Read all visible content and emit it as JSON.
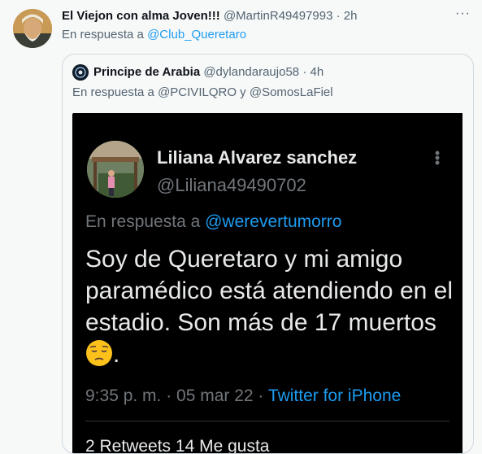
{
  "tweet": {
    "name": "El Viejon con alma Joven!!!",
    "handle": "@MartinR49497993",
    "sep": "·",
    "time": "2h",
    "more": "···",
    "reply_prefix": "En respuesta a",
    "reply_mention": "@Club_Queretaro"
  },
  "quote": {
    "name": "Principe de Arabia",
    "handle": "@dylandaraujo58",
    "sep": "·",
    "time": "4h",
    "reply_prefix": "En respuesta a",
    "reply_mention_1": "@PCIVILQRO",
    "reply_and": "y",
    "reply_mention_2": "@SomosLaFiel"
  },
  "screenshot": {
    "name": "Liliana Alvarez sanchez",
    "handle": "@Liliana49490702",
    "reply_prefix": "En respuesta a",
    "reply_mention": "@werevertumorro",
    "body": "Soy de Queretaro y mi amigo paramédico está atendiendo en el estadio. Son más de 17 muertos",
    "body_end": ".",
    "emoji": "pensive-face",
    "meta_time": "9:35 p. m. · 05 mar 22 ·",
    "meta_source": "Twitter for iPhone",
    "stats": "2 Retweets   14 Me gusta"
  },
  "colors": {
    "accent": "#1d9bf0",
    "background": "#f7f9f9",
    "screenshot_bg": "#000000"
  }
}
